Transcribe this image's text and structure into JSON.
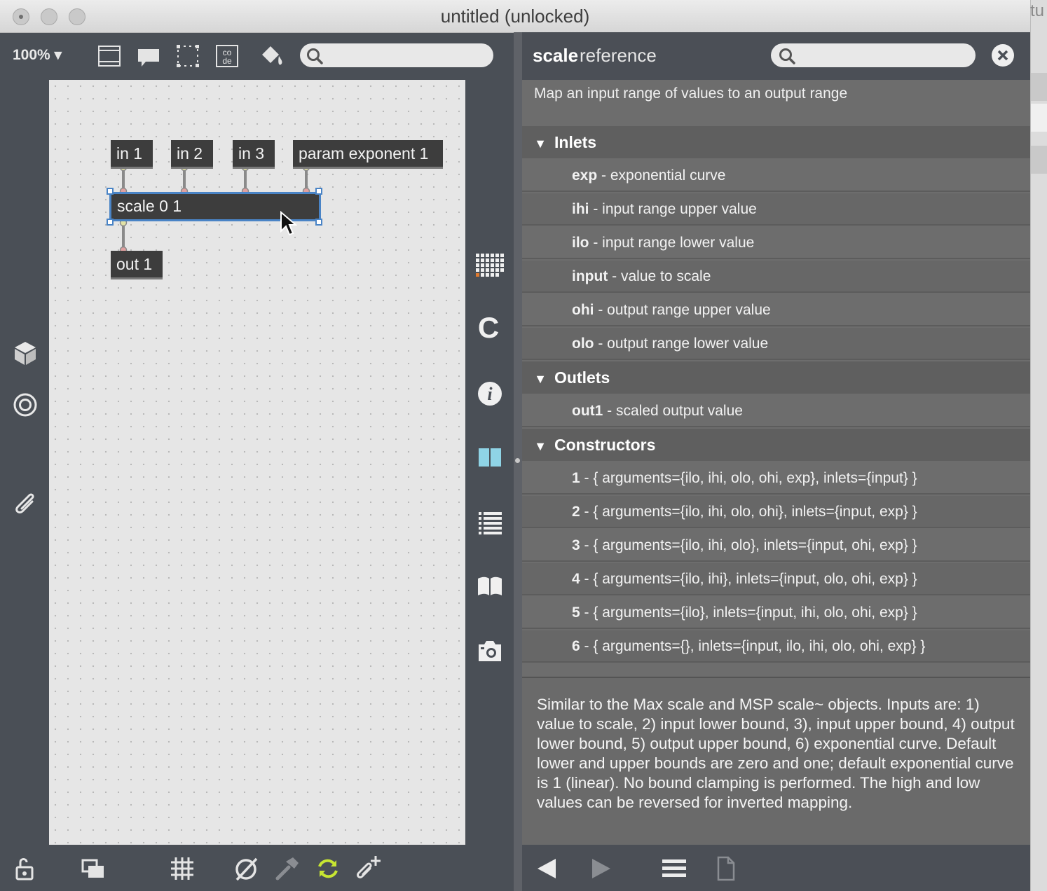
{
  "window": {
    "title": "untitled (unlocked)",
    "background_window_text": "tu"
  },
  "toolbar": {
    "zoom": "100% ▾",
    "search_placeholder": ""
  },
  "patch": {
    "objects": {
      "in1": "in 1",
      "in2": "in 2",
      "in3": "in 3",
      "param": "param exponent 1",
      "scale": "scale 0 1",
      "out1": "out 1"
    }
  },
  "reference": {
    "object_name": "scale",
    "title_suffix": "reference",
    "search_placeholder": "",
    "description": "Map an input range of values to an output range",
    "inlets_label": "Inlets",
    "inlets": [
      {
        "name": "exp",
        "desc": " - exponential curve"
      },
      {
        "name": "ihi",
        "desc": " - input range upper value"
      },
      {
        "name": "ilo",
        "desc": " - input range lower value"
      },
      {
        "name": "input",
        "desc": " - value to scale"
      },
      {
        "name": "ohi",
        "desc": " - output range upper value"
      },
      {
        "name": "olo",
        "desc": " - output range lower value"
      }
    ],
    "outlets_label": "Outlets",
    "outlets": [
      {
        "name": "out1",
        "desc": " - scaled output value"
      }
    ],
    "constructors_label": "Constructors",
    "constructors": [
      {
        "name": "1",
        "desc": " - { arguments={ilo, ihi, olo, ohi, exp}, inlets={input} }"
      },
      {
        "name": "2",
        "desc": " - { arguments={ilo, ihi, olo, ohi}, inlets={input, exp} }"
      },
      {
        "name": "3",
        "desc": " - { arguments={ilo, ihi, olo}, inlets={input, ohi, exp} }"
      },
      {
        "name": "4",
        "desc": " - { arguments={ilo, ihi}, inlets={input, olo, ohi, exp} }"
      },
      {
        "name": "5",
        "desc": " - { arguments={ilo}, inlets={input, ihi, olo, ohi, exp} }"
      },
      {
        "name": "6",
        "desc": " - { arguments={}, inlets={input, ilo, ihi, olo, ohi, exp} }"
      }
    ],
    "long_description": "Similar to the Max scale and MSP scale~ objects. Inputs are: 1) value to scale, 2) input lower bound, 3), input upper bound, 4) output lower bound, 5) output upper bound, 6) exponential curve. Default lower and upper bounds are zero and one; default exponential curve is 1 (linear). No bound clamping is performed. The high and low values can be reversed for inverted mapping."
  },
  "icons": {
    "toolbar": [
      "presentation-icon",
      "comment-icon",
      "selection-icon",
      "code-icon",
      "paint-bucket-icon",
      "search-icon"
    ],
    "left_strip": [
      "cube-icon",
      "target-icon",
      "paperclip-icon"
    ],
    "right_strip": [
      "grid-icon",
      "c-icon",
      "info-icon",
      "book-open-icon",
      "list-icon",
      "reference-book-icon",
      "camera-icon"
    ],
    "bottom_left": [
      "lock-icon",
      "layers-icon",
      "grid-icon",
      "no-icon",
      "hammer-icon",
      "refresh-icon",
      "attach-icon"
    ],
    "bottom_right": [
      "back-arrow-icon",
      "forward-arrow-icon",
      "menu-icon",
      "page-icon"
    ]
  },
  "colors": {
    "accent_selection": "#4a84c6",
    "refresh_icon": "#c8e632"
  }
}
